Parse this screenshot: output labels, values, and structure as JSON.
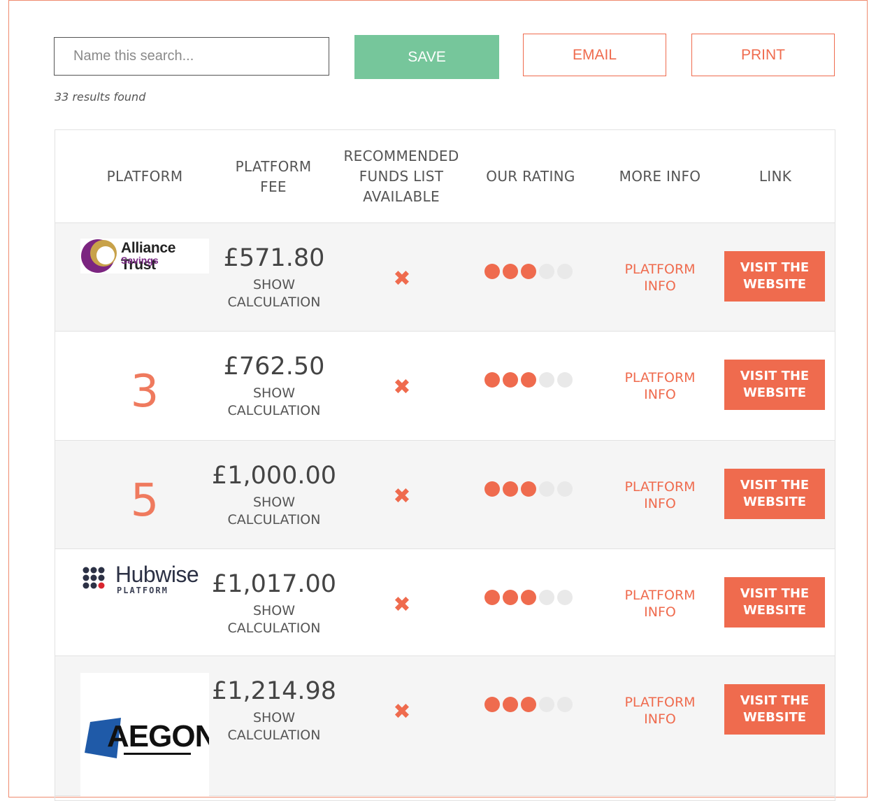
{
  "toolbar": {
    "search_placeholder": "Name this search...",
    "save_label": "SAVE",
    "email_label": "EMAIL",
    "print_label": "PRINT"
  },
  "results_text": "33 results found",
  "table": {
    "headers": {
      "platform": "PLATFORM",
      "fee_line1": "PLATFORM",
      "fee_line2": "FEE",
      "funds_line1": "RECOMMENDED",
      "funds_line2": "FUNDS LIST",
      "funds_line3": "AVAILABLE",
      "rating": "OUR RATING",
      "more_info": "MORE INFO",
      "link": "LINK"
    },
    "rows": [
      {
        "platform_type": "logo",
        "logo_name": "Alliance Trust",
        "logo_sub": "Savings",
        "fee": "£571.80",
        "calc_line1": "SHOW",
        "calc_line2": "CALCULATION",
        "funds_list": "✖",
        "rating": 3,
        "rating_max": 5,
        "info_label": "PLATFORM INFO",
        "visit_line1": "VISIT THE",
        "visit_line2": "WEBSITE"
      },
      {
        "platform_type": "rank",
        "rank": "3",
        "fee": "£762.50",
        "calc_line1": "SHOW",
        "calc_line2": "CALCULATION",
        "funds_list": "✖",
        "rating": 3,
        "rating_max": 5,
        "info_label": "PLATFORM INFO",
        "visit_line1": "VISIT THE",
        "visit_line2": "WEBSITE"
      },
      {
        "platform_type": "rank",
        "rank": "5",
        "fee": "£1,000.00",
        "calc_line1": "SHOW",
        "calc_line2": "CALCULATION",
        "funds_list": "✖",
        "rating": 3,
        "rating_max": 5,
        "info_label": "PLATFORM INFO",
        "visit_line1": "VISIT THE",
        "visit_line2": "WEBSITE"
      },
      {
        "platform_type": "logo",
        "logo_name": "Hubwise",
        "logo_sub": "PLATFORM",
        "fee": "£1,017.00",
        "calc_line1": "SHOW",
        "calc_line2": "CALCULATION",
        "funds_list": "✖",
        "rating": 3,
        "rating_max": 5,
        "info_label": "PLATFORM INFO",
        "visit_line1": "VISIT THE",
        "visit_line2": "WEBSITE"
      },
      {
        "platform_type": "logo",
        "logo_name": "AEGON",
        "fee": "£1,214.98",
        "calc_line1": "SHOW",
        "calc_line2": "CALCULATION",
        "funds_list": "✖",
        "rating": 3,
        "rating_max": 5,
        "info_label": "PLATFORM INFO",
        "visit_line1": "VISIT THE",
        "visit_line2": "WEBSITE"
      }
    ]
  },
  "colors": {
    "accent": "#ef6b4e",
    "save_green": "#76c69b",
    "rank_number": "#ef7a5e",
    "dot_off": "#e9e9e9",
    "row_alt": "#f5f5f5"
  }
}
